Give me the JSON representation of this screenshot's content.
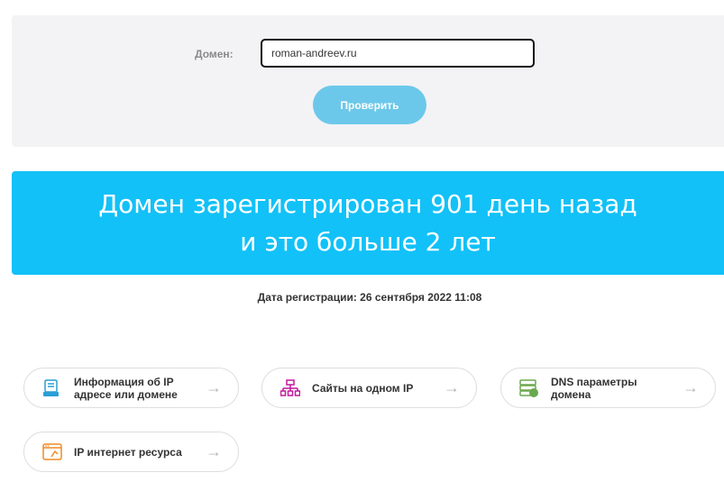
{
  "form": {
    "domain_label": "Домен:",
    "domain_value": "roman-andreev.ru",
    "check_button": "Проверить"
  },
  "result": {
    "line1": "Домен зарегистрирован 901 день назад",
    "line2": "и это больше 2 лет"
  },
  "registration_date": "Дата регистрации: 26 сентября 2022 11:08",
  "cards": [
    {
      "label_line1": "Информация об IP",
      "label_line2": "адресе или домене",
      "icon": "ip-info-icon",
      "icon_color": "#2a9fd6"
    },
    {
      "label_line1": "Сайты на одном IP",
      "label_line2": "",
      "icon": "sitemap-icon",
      "icon_color": "#c2189b"
    },
    {
      "label_line1": "DNS параметры",
      "label_line2": "домена",
      "icon": "dns-server-icon",
      "icon_color": "#6aa84f"
    },
    {
      "label_line1": "IP интернет ресурса",
      "label_line2": "",
      "icon": "browser-ip-icon",
      "icon_color": "#f08a24"
    }
  ],
  "arrow_glyph": "→",
  "colors": {
    "banner": "#12c1f7",
    "button": "#6cc8ea",
    "panel": "#f3f3f5"
  }
}
